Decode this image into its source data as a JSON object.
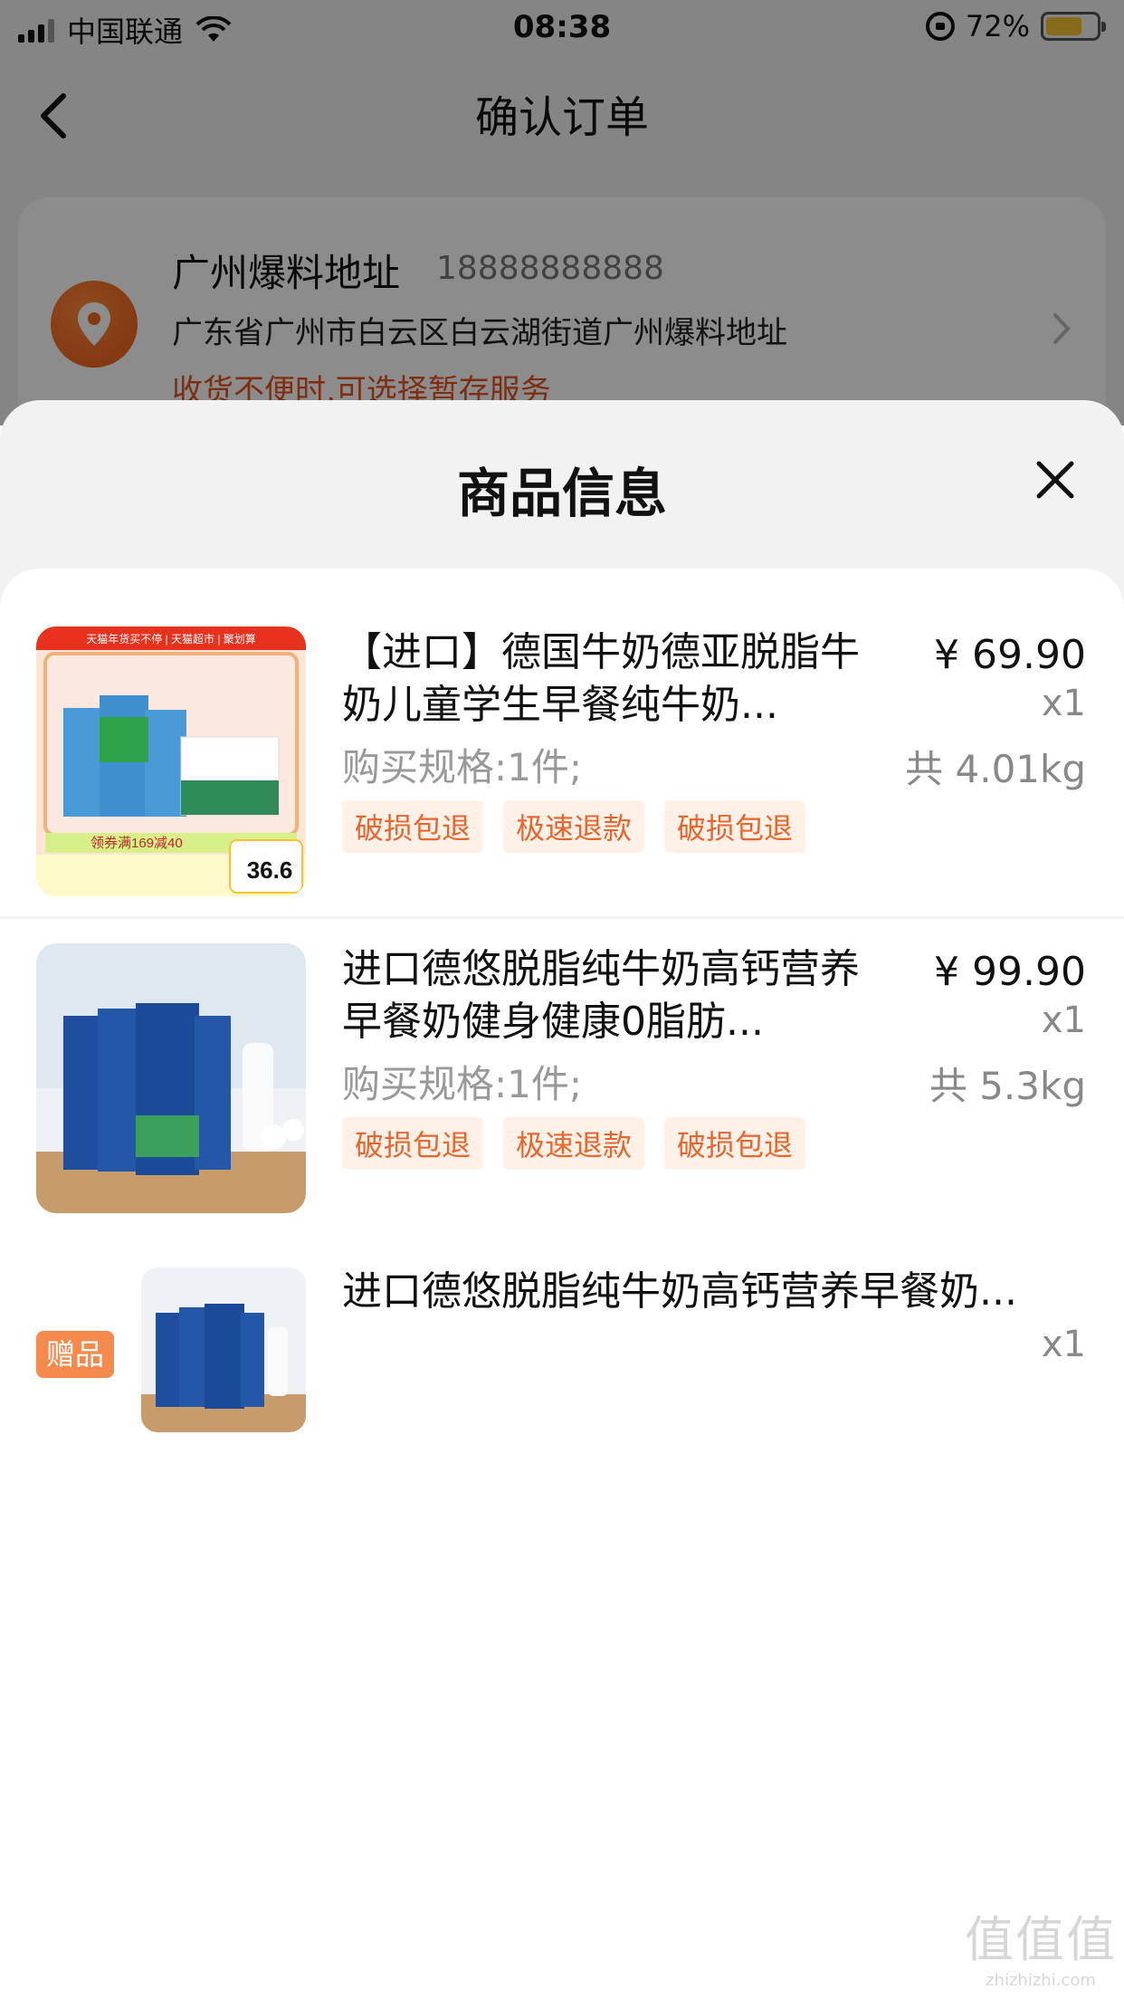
{
  "status_bar": {
    "carrier": "中国联通",
    "time": "08:38",
    "battery_percent": "72%",
    "battery_level": 0.72
  },
  "nav": {
    "title": "确认订单",
    "back_icon": "chevron-left-icon"
  },
  "address": {
    "name": "广州爆料地址",
    "phone": "18888888888",
    "detail": "广东省广州市白云区白云湖街道广州爆料地址",
    "tip": "收货不便时,可选择暂存服务",
    "icon": "location-pin-icon"
  },
  "sheet": {
    "title": "商品信息",
    "close_icon": "close-icon"
  },
  "items": [
    {
      "title": "【进口】德国牛奶德亚脱脂牛奶儿童学生早餐纯牛奶...",
      "price": "¥ 69.90",
      "qty": "x1",
      "weight": "共 4.01kg",
      "spec": "购买规格:1件;",
      "tags": [
        "破损包退",
        "极速退款",
        "破损包退"
      ]
    },
    {
      "title": "进口德悠脱脂纯牛奶高钙营养早餐奶健身健康0脂肪...",
      "price": "¥ 99.90",
      "qty": "x1",
      "weight": "共 5.3kg",
      "spec": "购买规格:1件;",
      "tags": [
        "破损包退",
        "极速退款",
        "破损包退"
      ]
    }
  ],
  "gift": {
    "badge": "赠品",
    "title": "进口德悠脱脂纯牛奶高钙营养早餐奶...",
    "qty": "x1"
  },
  "product_image_text": {
    "banner": "天猫年货买不停 | 天猫超市 | 聚划算",
    "coupon": "领券满169减40",
    "price": "36.6"
  },
  "watermark": {
    "logo": "值值值",
    "url": "zhizhizhi.com"
  },
  "colors": {
    "accent": "#e8531e",
    "tag_text": "#e8652c",
    "tag_bg": "#fff1e8",
    "gift_badge": "#f58a4c"
  }
}
